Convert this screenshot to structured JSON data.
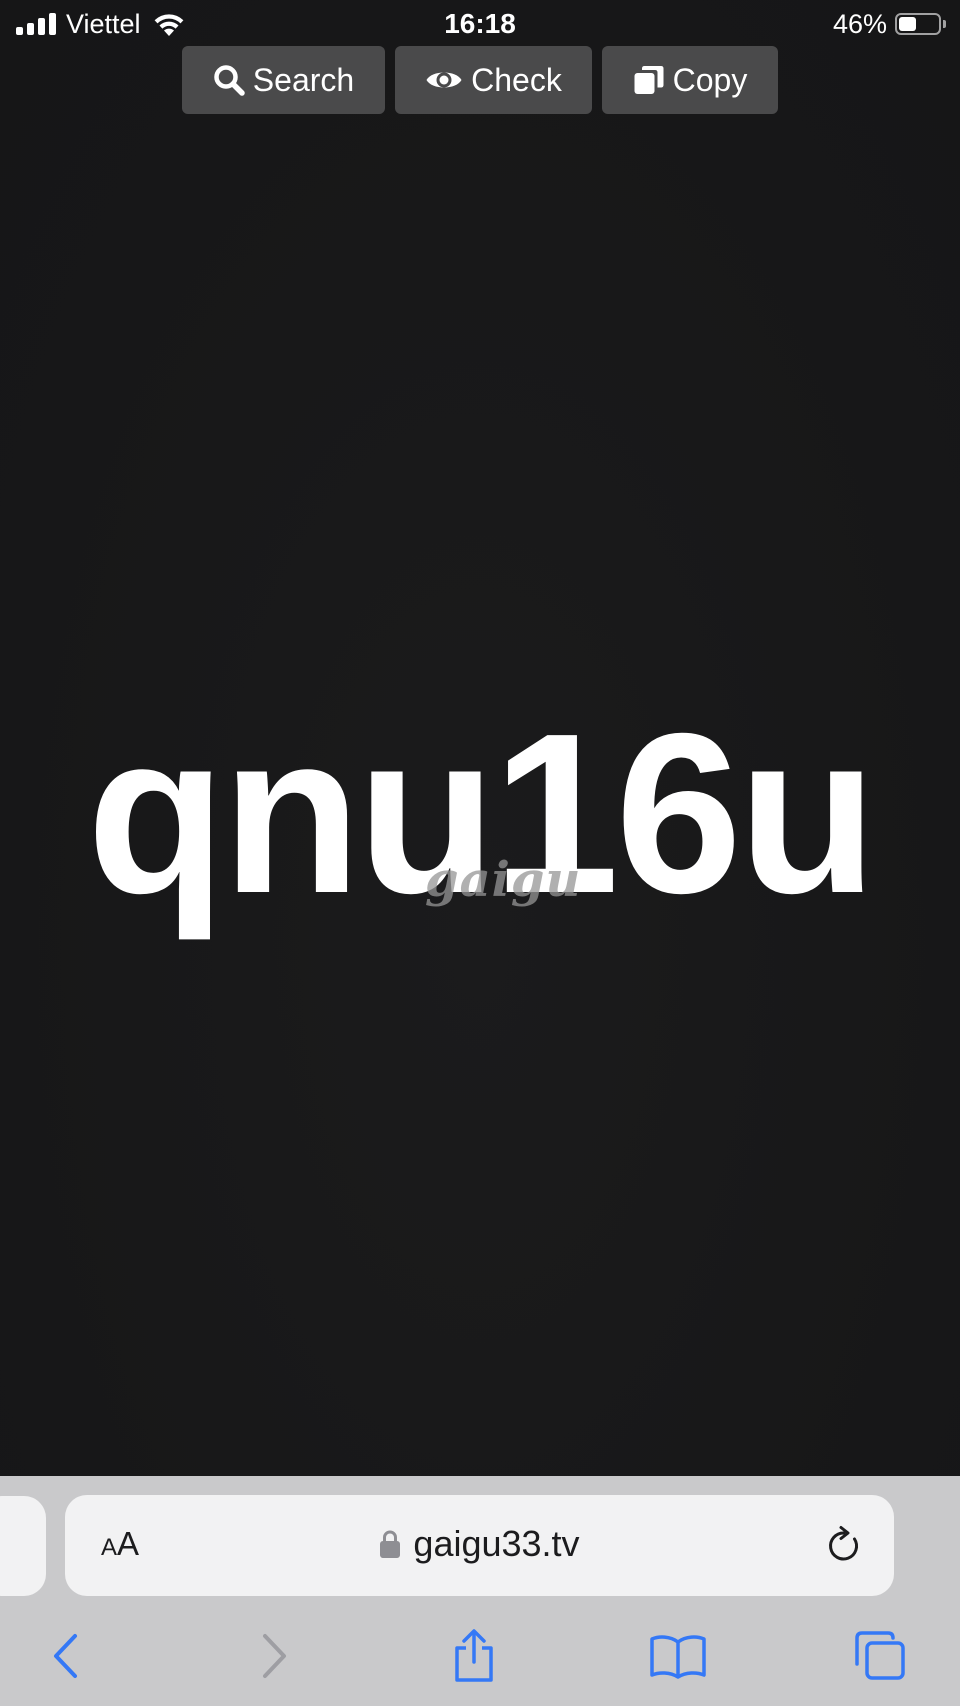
{
  "status_bar": {
    "carrier": "Viettel",
    "time": "16:18",
    "battery_percent_label": "46%",
    "battery_level": 0.46,
    "signal_icon": "cellular-signal-icon",
    "wifi_icon": "wifi-icon",
    "battery_icon": "battery-icon"
  },
  "actions": [
    {
      "label": "Search",
      "icon": "search-icon"
    },
    {
      "label": "Check",
      "icon": "eye-icon"
    },
    {
      "label": "Copy",
      "icon": "copy-icon"
    }
  ],
  "main": {
    "code": "qnu16u",
    "watermark": "gaigu"
  },
  "browser": {
    "text_size_small": "A",
    "text_size_big": "A",
    "url": "gaigu33.tv",
    "lock_icon": "lock-icon",
    "reload_icon": "reload-icon",
    "toolbar": [
      "back-icon",
      "forward-icon",
      "share-icon",
      "bookmarks-icon",
      "tabs-icon"
    ]
  },
  "colors": {
    "background": "#181819",
    "button_bg": "#4a4a4b",
    "chrome_bg": "#c9c9cb",
    "url_bar_bg": "#f2f2f3",
    "accent_blue": "#3478f6",
    "disabled_gray": "#9e9ea3"
  }
}
